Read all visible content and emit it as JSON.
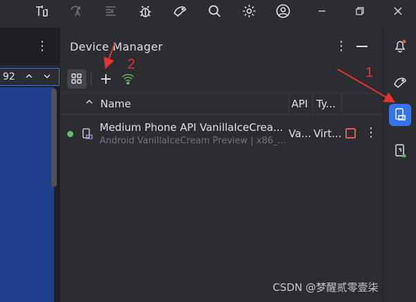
{
  "left_pane": {
    "zoom_value": "92",
    "kebab": "⋮",
    "zoom_up": "^",
    "zoom_down": "v"
  },
  "device_manager": {
    "title": "Device Manager",
    "kebab": "⋮",
    "add_label": "+",
    "columns": {
      "name": "Name",
      "api": "API",
      "type": "Ty..."
    },
    "devices": [
      {
        "name": "Medium Phone API VanillaIceCrea...",
        "subtitle": "Android VanillaIceCream Preview | x86_...",
        "api": "Va...",
        "type": "Virt...",
        "status": "running",
        "kebab": "⋮"
      }
    ]
  },
  "annotations": {
    "arrow1_label": "1",
    "arrow2_label": "2",
    "color": "#e8322e"
  },
  "watermark": "CSDN @梦醒贰零壹柒",
  "colors": {
    "accent": "#3574f0",
    "running": "#5fb865",
    "stop": "#db5c5c",
    "editor_blue": "#1d3e8a"
  }
}
